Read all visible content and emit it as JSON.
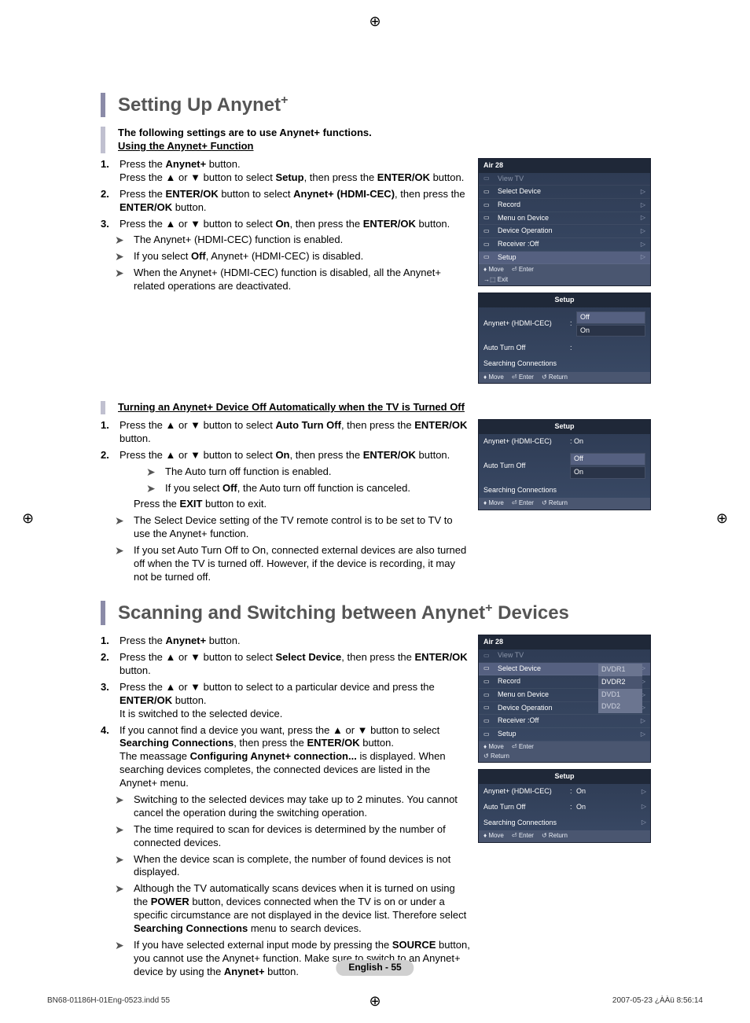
{
  "section1": {
    "title": "Setting Up Anynet",
    "titlePlus": "+",
    "intro": "The following settings are to use Anynet+ functions.",
    "sub1": "Using the Anynet+ Function",
    "steps1": [
      {
        "n": "1.",
        "t": "Press the <b>Anynet+</b> button.<br>Press the ▲ or ▼ button to select <b>Setup</b>, then press the <b>ENTER/OK</b> button."
      },
      {
        "n": "2.",
        "t": "Press the <b>ENTER/OK</b> button to select <b>Anynet+ (HDMI-CEC)</b>, then press the <b>ENTER/OK</b> button."
      },
      {
        "n": "3.",
        "t": "Press the ▲ or ▼ button to select <b>On</b>, then press the <b>ENTER/OK</b> button."
      }
    ],
    "notes1": [
      "The Anynet+ (HDMI-CEC) function is enabled.",
      "If you select <b>Off</b>, Anynet+ (HDMI-CEC) is disabled.",
      "When the Anynet+ (HDMI-CEC) function is disabled, all the Anynet+ related operations are deactivated."
    ],
    "sub2": "Turning an Anynet+ Device Off Automatically when the TV is Turned Off",
    "steps2": [
      {
        "n": "1.",
        "t": "Press the ▲ or ▼ button to select <b>Auto Turn Off</b>, then press the <b>ENTER/OK</b> button."
      },
      {
        "n": "2.",
        "t": "Press the ▲ or ▼ button to select <b>On</b>, then press the <b>ENTER/OK</b> button."
      }
    ],
    "subnotes2": [
      "The Auto turn off function is enabled.",
      "If you select <b>Off</b>, the Auto turn off function is canceled."
    ],
    "exitline": "Press the <b>EXIT</b> button to exit.",
    "notes2": [
      "The Select Device setting of the TV remote control is to be set to TV to use the Anynet+ function.",
      "If you set Auto Turn Off to On, connected external devices are also turned off when the TV is turned off. However, if the device is recording, it may not be turned off."
    ]
  },
  "section2": {
    "title": "Scanning and Switching between Anynet",
    "titlePlus": "+",
    "titleAfter": " Devices",
    "steps": [
      {
        "n": "1.",
        "t": "Press the <b>Anynet+</b> button."
      },
      {
        "n": "2.",
        "t": "Press the ▲ or ▼ button to select <b>Select Device</b>, then press the <b>ENTER/OK</b> button."
      },
      {
        "n": "3.",
        "t": "Press the ▲ or ▼ button to select to a particular device and press the <b>ENTER/OK</b> button.<br>It is switched to the selected device."
      },
      {
        "n": "4.",
        "t": "If you cannot find a device you want, press the ▲ or ▼ button to select <b>Searching Connections</b>, then press the <b>ENTER/OK</b> button.<br>The meassage <b>Configuring Anynet+ connection...</b> is displayed. When searching devices completes, the connected devices are listed in the Anynet+ menu."
      }
    ],
    "notes": [
      "Switching to the selected devices may take up to 2 minutes. You cannot cancel the operation during the switching operation.",
      "The time required to scan for devices is determined by the number of connected devices.",
      "When the device scan is complete, the number of found devices is not displayed.",
      "Although the TV automatically scans devices when it is turned on using the <b>POWER</b> button, devices connected when the TV is on or under a specific circumstance are not displayed in the device list. Therefore select <b>Searching Connections</b> menu to search devices.",
      "If you have selected external input mode by pressing the <b>SOURCE</b> button, you cannot use the Anynet+ function. Make sure to switch to an Anynet+ device by using the <b>Anynet+</b> button."
    ]
  },
  "osd": {
    "menu1": {
      "header": "Air 28",
      "items": [
        "View TV",
        "Select Device",
        "Record",
        "Menu on Device",
        "Device Operation",
        "Receiver   :Off",
        "Setup"
      ],
      "footer": [
        "Move",
        "Enter",
        "Exit"
      ]
    },
    "setup1": {
      "header": "Setup",
      "rows": [
        {
          "label": "Anynet+ (HDMI-CEC)",
          "colon": ":",
          "opts": [
            "Off",
            "On"
          ],
          "sel": 0
        },
        {
          "label": "Auto Turn Off",
          "colon": ":",
          "opts": []
        },
        {
          "label": "Searching Connections",
          "colon": "",
          "opts": []
        }
      ],
      "footer": [
        "Move",
        "Enter",
        "Return"
      ]
    },
    "setup2": {
      "header": "Setup",
      "rows": [
        {
          "label": "Anynet+ (HDMI-CEC)",
          "val": ": On"
        },
        {
          "label": "Auto Turn Off",
          "opts": [
            "Off",
            "On"
          ],
          "sel": 0
        },
        {
          "label": "Searching Connections"
        }
      ],
      "footer": [
        "Move",
        "Enter",
        "Return"
      ]
    },
    "menu2": {
      "header": "Air 28",
      "items": [
        "View TV",
        "Select Device",
        "Record",
        "Menu on Device",
        "Device Operation",
        "Receiver   :Off",
        "Setup"
      ],
      "popup": [
        "DVDR1",
        "DVDR2",
        "DVD1",
        "DVD2"
      ],
      "popupSel": 1,
      "footer": [
        "Move",
        "Enter",
        "Return"
      ]
    },
    "setup3": {
      "header": "Setup",
      "rows": [
        {
          "label": "Anynet+ (HDMI-CEC)",
          "colon": ":",
          "val": "On"
        },
        {
          "label": "Auto Turn Off",
          "colon": ":",
          "val": "On"
        },
        {
          "label": "Searching Connections",
          "colon": "",
          "val": ""
        }
      ],
      "footer": [
        "Move",
        "Enter",
        "Return"
      ]
    }
  },
  "pagePill": "English - 55",
  "docFooter": {
    "left": "BN68-01186H-01Eng-0523.indd   55",
    "right": "2007-05-23   ¿ÀÀü 8:56:14"
  }
}
